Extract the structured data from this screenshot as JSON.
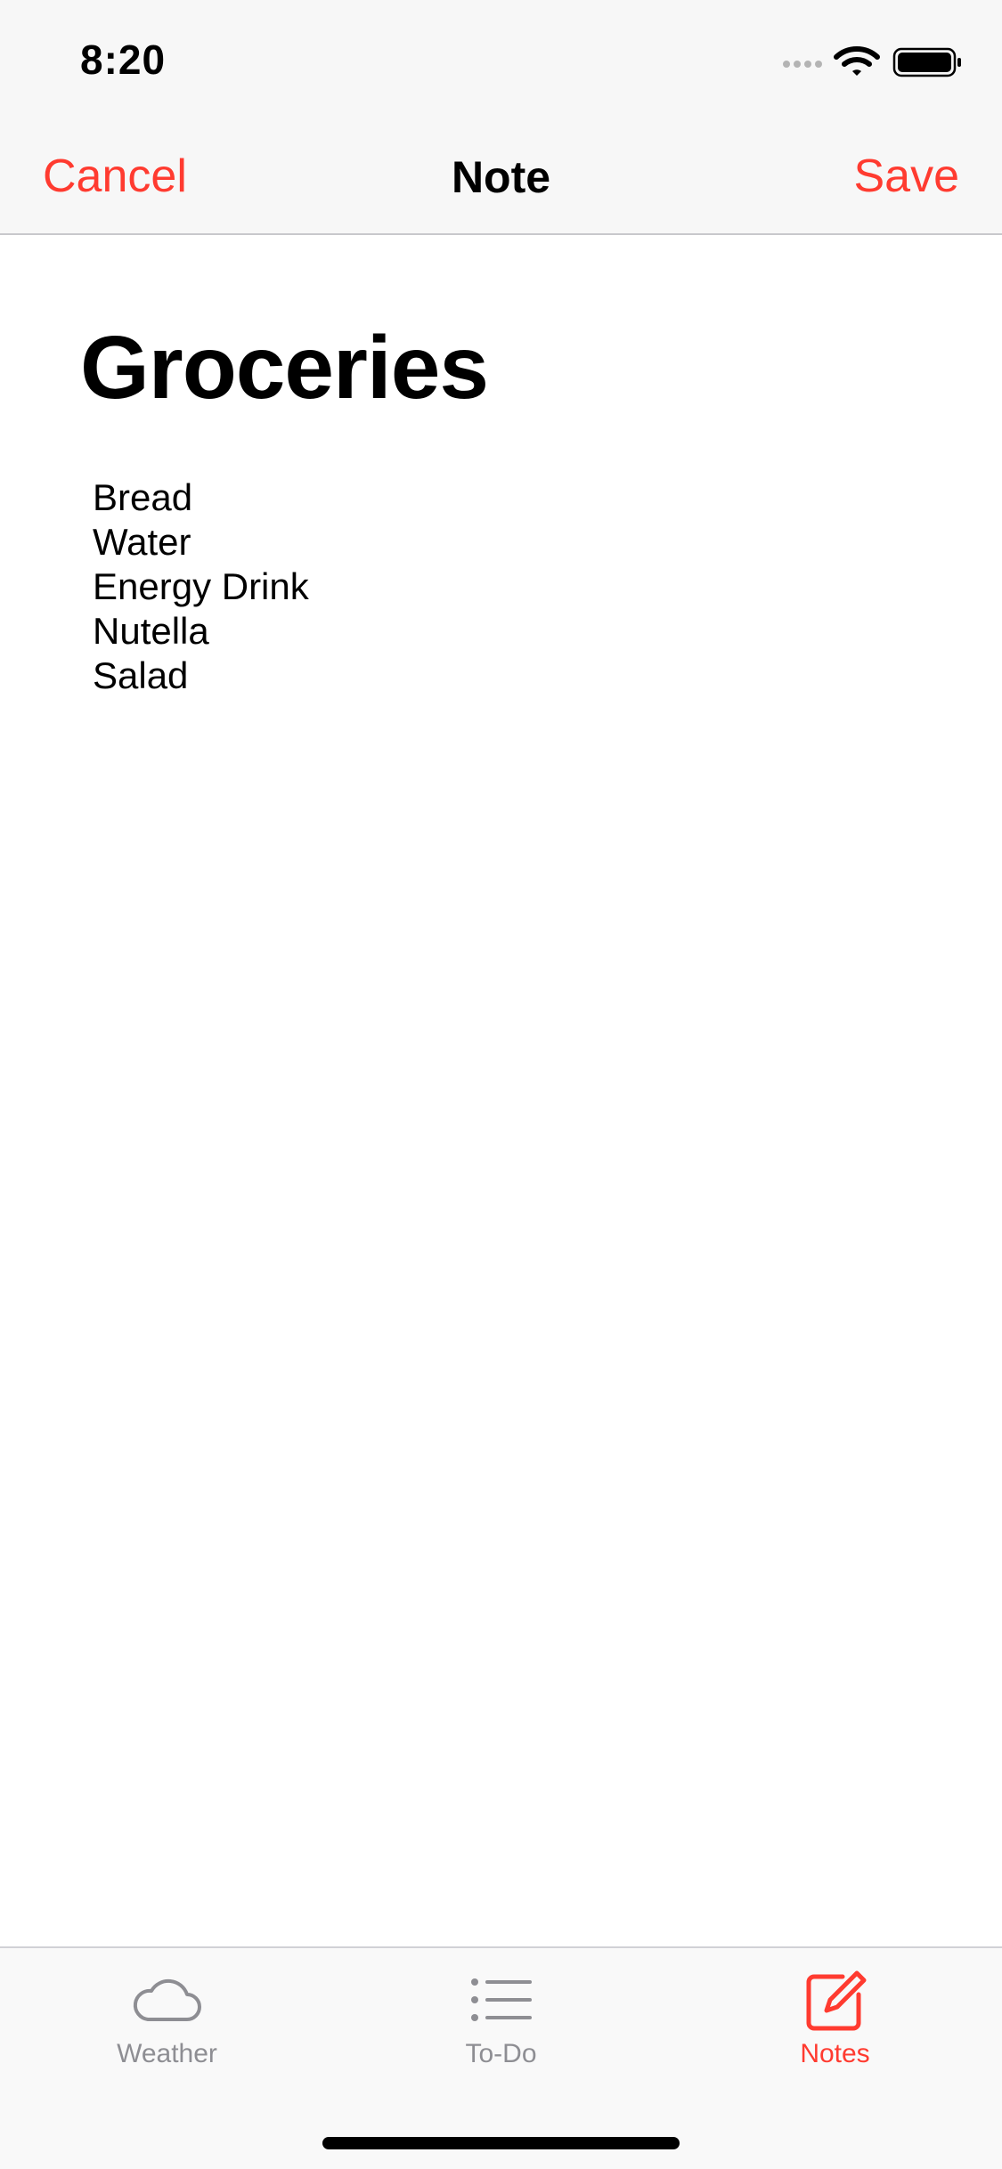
{
  "status": {
    "time": "8:20",
    "signal_icon": "signal-dots-icon",
    "wifi_icon": "wifi-icon",
    "battery_icon": "battery-icon"
  },
  "nav": {
    "cancel_label": "Cancel",
    "title": "Note",
    "save_label": "Save",
    "accent_color": "#ff3b30"
  },
  "note": {
    "title": "Groceries",
    "body": "Bread\nWater\nEnergy Drink\nNutella\nSalad"
  },
  "tabs": [
    {
      "label": "Weather",
      "icon": "cloud-icon",
      "active": false
    },
    {
      "label": "To-Do",
      "icon": "list-icon",
      "active": false
    },
    {
      "label": "Notes",
      "icon": "compose-icon",
      "active": true
    }
  ],
  "colors": {
    "accent": "#ff3b30",
    "inactive": "#8e8e93",
    "bar_background": "#f7f7f7"
  }
}
